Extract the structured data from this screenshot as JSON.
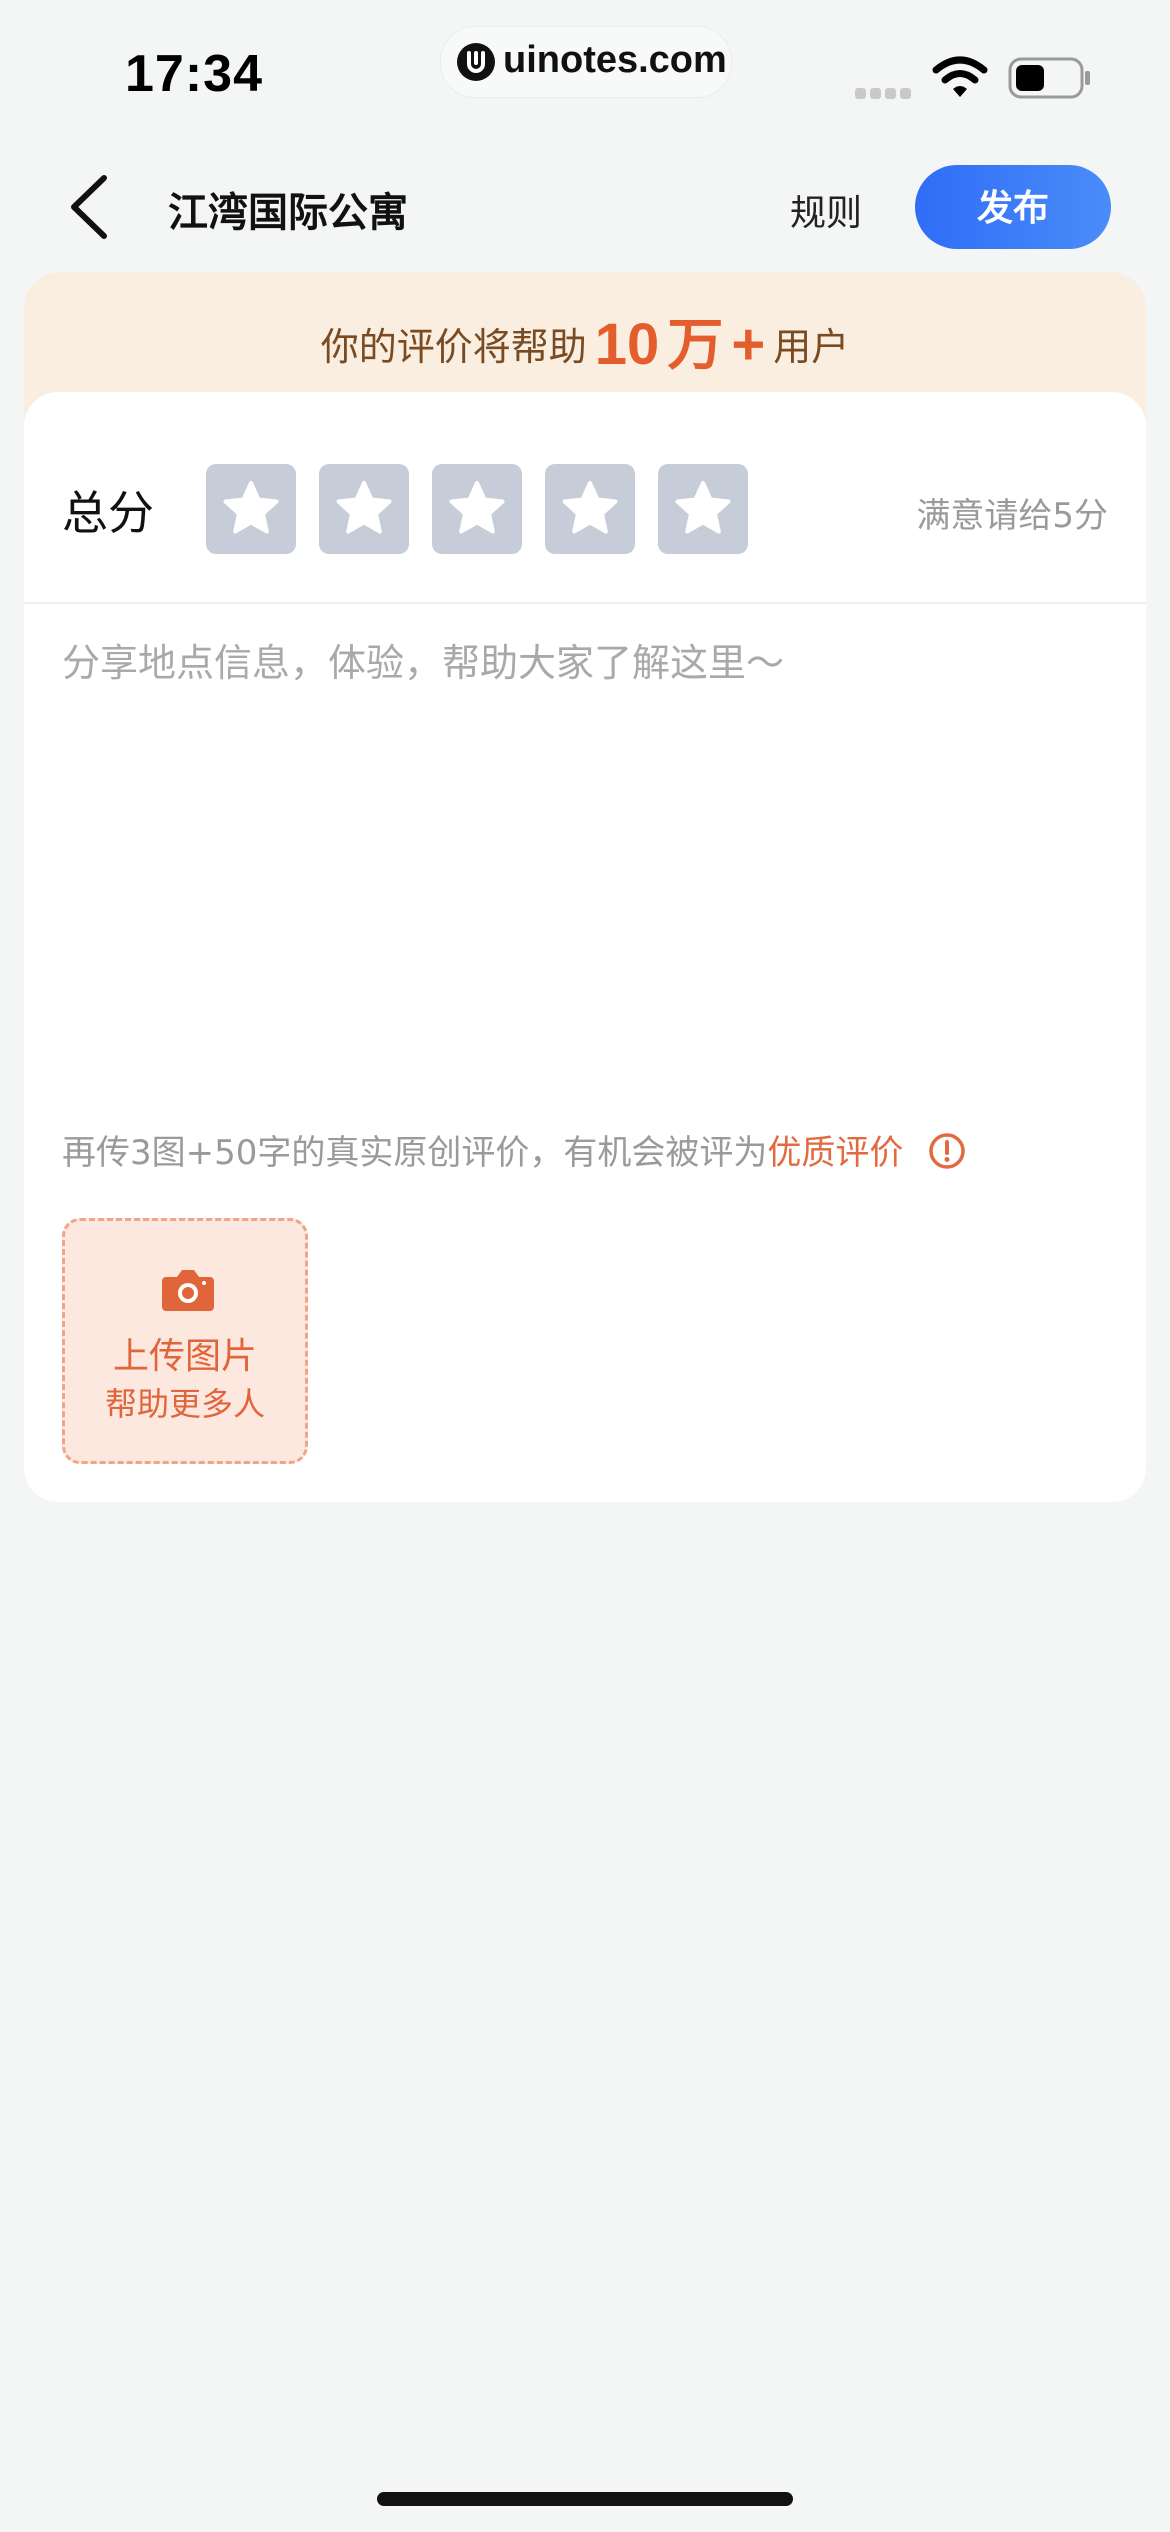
{
  "status_bar": {
    "time": "17:34",
    "watermark": "uinotes.com"
  },
  "nav": {
    "title": "江湾国际公寓",
    "rules_label": "规则",
    "publish_label": "发布"
  },
  "banner": {
    "prefix": "你的评价将帮助",
    "count_number": "10",
    "count_unit": "万",
    "plus": "+",
    "suffix": "用户"
  },
  "rating": {
    "label": "总分",
    "star_count": 5,
    "hint": "满意请给5分",
    "star_tile_color": "#c7ccd9"
  },
  "review": {
    "placeholder": "分享地点信息，体验，帮助大家了解这里～"
  },
  "quality_tip": {
    "text": "再传3图+50字的真实原创评价，有机会被评为",
    "link": "优质评价"
  },
  "upload": {
    "line1": "上传图片",
    "line2": "帮助更多人"
  },
  "colors": {
    "accent_blue": "#2f6df7",
    "accent_orange": "#e35d2d",
    "banner_bg": "#f9eee0"
  }
}
